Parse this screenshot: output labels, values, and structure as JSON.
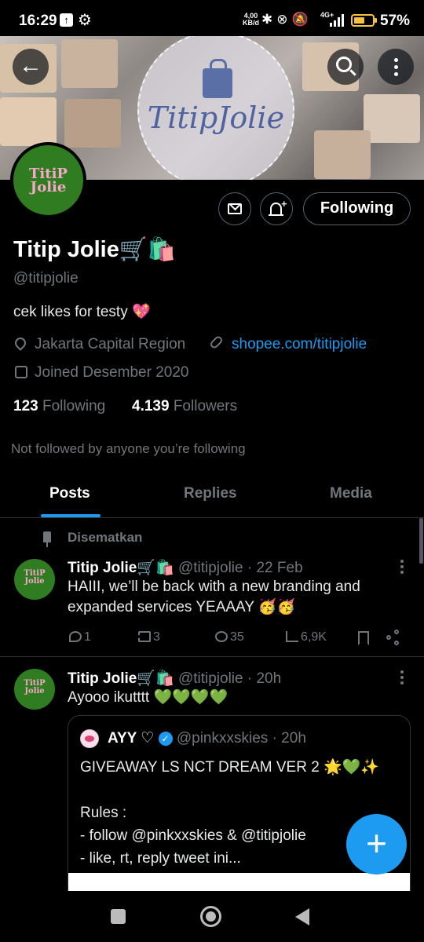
{
  "status_bar": {
    "time": "16:29",
    "net_speed_value": "4,00",
    "net_speed_unit": "KB/d",
    "signal_label": "4G+",
    "battery": "57%",
    "battery_level": 0.57
  },
  "banner": {
    "logo_text": "TitipJolie"
  },
  "profile": {
    "avatar_logo": "TitiP Jolie",
    "display_name": "Titip Jolie🛒🛍️",
    "handle": "@titipjolie",
    "bio": "cek likes for testy 💖",
    "location": "Jakarta Capital Region",
    "link": "shopee.com/titipjolie",
    "joined": "Joined Desember 2020",
    "following_count": "123",
    "following_label": "Following",
    "followers_count": "4.139",
    "followers_label": "Followers",
    "not_followed_text": "Not followed by anyone you’re following",
    "following_button": "Following"
  },
  "tabs": [
    {
      "label": "Posts",
      "active": true
    },
    {
      "label": "Replies",
      "active": false
    },
    {
      "label": "Media",
      "active": false
    }
  ],
  "posts": [
    {
      "pinned_label": "Disematkan",
      "author": "Titip Jolie🛒🛍️",
      "handle": "@titipjolie",
      "time": "· 22 Feb",
      "text": "HAIII, we’ll be back with a new branding and expanded services YEAAAY 🥳🥳",
      "replies": "1",
      "reposts": "3",
      "likes": "35",
      "views": "6,9K"
    },
    {
      "author": "Titip Jolie🛒🛍️",
      "handle": "@titipjolie",
      "time": "· 20h",
      "text": "Ayooo ikutttt 💚💚💚💚",
      "quote": {
        "author": "AYY ♡",
        "handle": "@pinkxxskies",
        "time": "· 20h",
        "body": "GIVEAWAY LS NCT DREAM VER 2 🌟💚✨\n\nRules :\n- follow @pinkxxskies & @titipjolie\n- like, rt, reply tweet ini..."
      }
    }
  ],
  "colors": {
    "accent": "#1d9bf0",
    "avatar_green": "#2f7d20",
    "muted": "#71767b"
  },
  "icons": [
    "arrow-left-icon",
    "search-icon",
    "more-icon",
    "mail-icon",
    "bell-plus-icon",
    "location-icon",
    "link-icon",
    "calendar-icon",
    "pin-icon",
    "reply-icon",
    "repost-icon",
    "like-icon",
    "views-icon",
    "bookmark-icon",
    "share-icon",
    "verified-icon",
    "plus-icon"
  ]
}
